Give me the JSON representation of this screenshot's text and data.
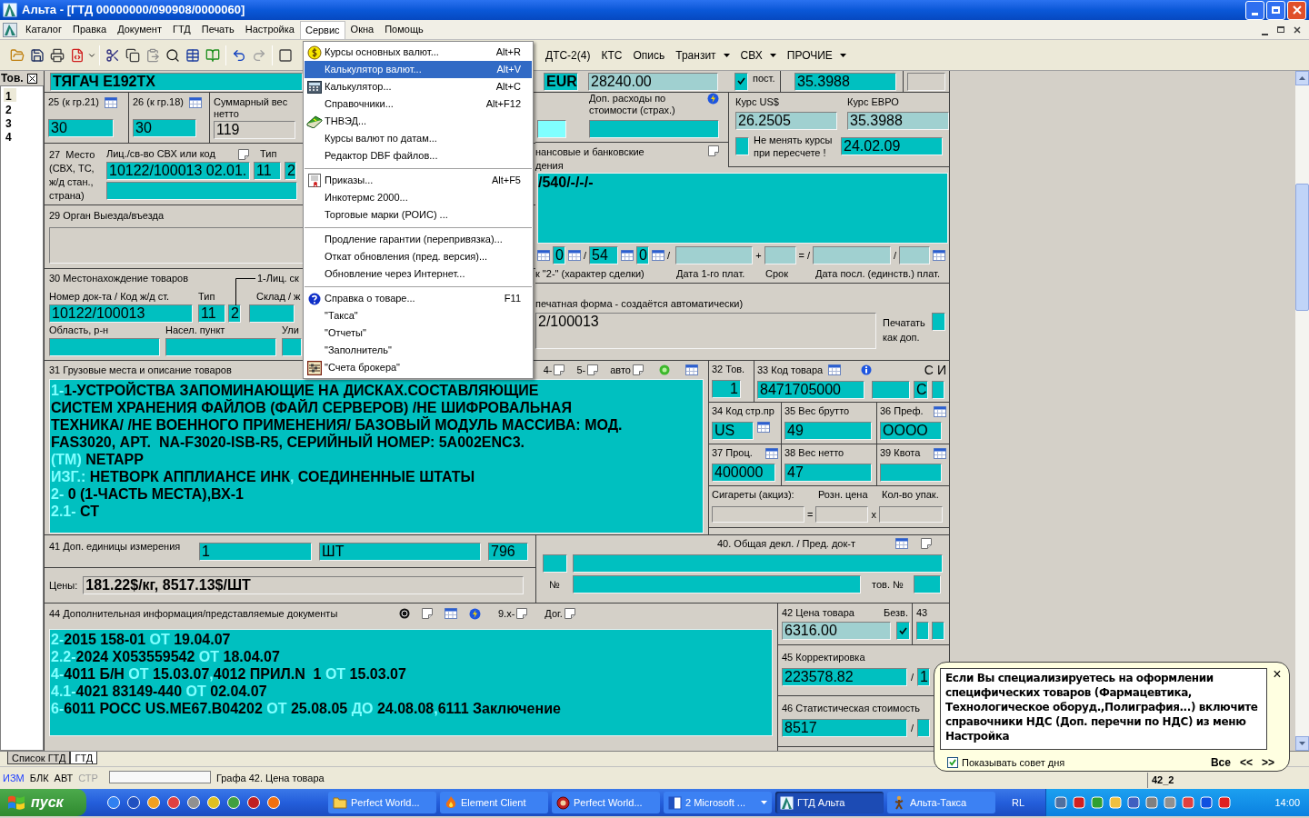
{
  "window": {
    "title": "Альта - [ГТД 00000000/090908/0000060]"
  },
  "menu_bar": [
    {
      "label": "Каталог",
      "selected": false
    },
    {
      "label": "Правка",
      "selected": false
    },
    {
      "label": "Документ",
      "selected": false
    },
    {
      "label": "ГТД",
      "selected": false
    },
    {
      "label": "Печать",
      "selected": false
    },
    {
      "label": "Настройка",
      "selected": false
    },
    {
      "label": "Сервис",
      "selected": true
    },
    {
      "label": "Окна",
      "selected": false
    },
    {
      "label": "Помощь",
      "selected": false
    }
  ],
  "toolbar": {
    "buttons": [
      {
        "label": "ДТС-2(4)",
        "dropdown": false
      },
      {
        "label": "КТС",
        "dropdown": false
      },
      {
        "label": "Опись",
        "dropdown": false
      },
      {
        "label": "Транзит",
        "dropdown": true
      },
      {
        "label": "СВХ",
        "dropdown": true
      },
      {
        "label": "ПРОЧИЕ",
        "dropdown": true
      }
    ]
  },
  "service_menu": {
    "items": [
      {
        "kind": "item",
        "label": "Курсы основных валют...",
        "shortcut": "Alt+R",
        "selected": false
      },
      {
        "kind": "item",
        "label": "Калькулятор валют...",
        "shortcut": "Alt+V",
        "selected": true
      },
      {
        "kind": "item",
        "label": "Калькулятор...",
        "shortcut": "Alt+C",
        "selected": false
      },
      {
        "kind": "item",
        "label": "Справочники...",
        "shortcut": "Alt+F12",
        "selected": false
      },
      {
        "kind": "item",
        "label": "ТНВЭД...",
        "selected": false
      },
      {
        "kind": "item",
        "label": "Курсы валют по датам...",
        "selected": false
      },
      {
        "kind": "item",
        "label": "Редактор DBF файлов...",
        "selected": false
      },
      {
        "kind": "separator"
      },
      {
        "kind": "item",
        "label": "Приказы...",
        "shortcut": "Alt+F5",
        "selected": false
      },
      {
        "kind": "item",
        "label": "Инкотермс 2000...",
        "selected": false
      },
      {
        "kind": "item",
        "label": "Торговые марки (РОИС) ...",
        "selected": false
      },
      {
        "kind": "separator"
      },
      {
        "kind": "item",
        "label": "Продление гарантии (перепривязка)...",
        "selected": false
      },
      {
        "kind": "item",
        "label": "Откат обновления (пред. версия)...",
        "selected": false
      },
      {
        "kind": "item",
        "label": "Обновление через Интернет...",
        "selected": false
      },
      {
        "kind": "separator"
      },
      {
        "kind": "item",
        "label": "Справка о товаре...",
        "shortcut": "F11",
        "selected": false
      },
      {
        "kind": "item",
        "label": "\"Такса\"",
        "selected": false
      },
      {
        "kind": "item",
        "label": "\"Отчеты\"",
        "selected": false
      },
      {
        "kind": "item",
        "label": "\"Заполнитель\"",
        "selected": false
      },
      {
        "kind": "item",
        "label": "\"Счета брокера\"",
        "selected": false
      }
    ]
  },
  "goods_list": {
    "title": "Тов.",
    "items": [
      {
        "label": "1",
        "selected": true
      },
      {
        "label": "2",
        "selected": false
      },
      {
        "label": "3",
        "selected": false
      },
      {
        "label": "4",
        "selected": false
      }
    ]
  },
  "header_row": {
    "description": "ТЯГАЧ Е192ТХ",
    "currency": "EUR",
    "amount": "28240.00",
    "fixed": {
      "label": "пост.",
      "checked": true
    },
    "rate": "35.3988"
  },
  "box25": {
    "label": "25 (к гр.21)",
    "value": "30"
  },
  "box26": {
    "label": "26 (к гр.18)",
    "value": "30"
  },
  "net_total": {
    "label": "Суммарный вес нетто",
    "value": "119"
  },
  "extra_costs": {
    "label": "Доп. расходы по стоимости (страх.)"
  },
  "rates": {
    "usd_label": "Курс US$",
    "usd": "26.2505",
    "eur_label": "Курс ЕВРО",
    "eur": "35.3988",
    "keep": {
      "label": "Не менять курсы при пересчете !",
      "checked": false
    },
    "date": "24.02.09"
  },
  "box27": {
    "label": "27  Место (СВХ, ТС, ж/д стан., страна)",
    "license_label": "Лиц./св-во СВХ или код",
    "type_label": "Тип",
    "license": "10122/100013 02.01.",
    "type": "11",
    "code": "2"
  },
  "finance": {
    "label_lines": [
      "нансовые и банковские",
      "дения"
    ],
    "value": "/540/-/-/-",
    "terms": [
      "0",
      "54",
      "0"
    ],
    "signs": [
      "/",
      "/",
      "+",
      "= /",
      "/"
    ],
    "captions": [
      "к \"2-\" (характер сделки)",
      "Дата 1-го плат.",
      "Срок",
      "Дата посл. (единств.) плат."
    ]
  },
  "box29": {
    "label": "29 Орган Выезда/въезда"
  },
  "box30": {
    "label": "30 Местонахождение товаров",
    "license_caption": "1-Лиц. ск",
    "doc_label": "Номер док-та / Код ж/д ст.",
    "type_label": "Тип",
    "store_label": "Склад / ж",
    "doc": "10122/100013",
    "type": "11",
    "code": "2",
    "region_label": "Область, р-н",
    "town_label": "Насел. пункт",
    "street_label": "Ули"
  },
  "print_form": {
    "label": "печатная форма - создаётся автоматически)",
    "value": "2/100013",
    "extra_label": "Печатать как доп.",
    "extra_checked": false
  },
  "box31": {
    "label": "31 Грузовые места и описание товаров",
    "tools": [
      "4-",
      "5-",
      "авто"
    ],
    "lines": [
      [
        {
          "kind": "marker",
          "text": "1-"
        },
        {
          "kind": "text",
          "text": "1-УСТРОЙСТВА ЗАПОМИНАЮЩИЕ НА ДИСКАХ.СОСТАВЛЯЮЩИЕ"
        }
      ],
      [
        {
          "kind": "text",
          "text": "СИСТЕМ ХРАНЕНИЯ ФАЙЛОВ (ФАЙЛ СЕРВЕРОВ) /НЕ ШИФРОВАЛЬНАЯ"
        }
      ],
      [
        {
          "kind": "text",
          "text": "ТЕХНИКА/ /НЕ ВОЕННОГО ПРИМЕНЕНИЯ/ БАЗОВЫЙ МОДУЛЬ МАССИВА: МОД."
        }
      ],
      [
        {
          "kind": "text",
          "text": "FAS3020, АРТ.  NA-F3020-ISB-R5, СЕРИЙНЫЙ НОМЕР: 5A002ENC3."
        }
      ],
      [
        {
          "kind": "marker",
          "text": "(ТМ) "
        },
        {
          "kind": "text",
          "text": "NETAPP"
        }
      ],
      [
        {
          "kind": "marker",
          "text": "ИЗГ.: "
        },
        {
          "kind": "text",
          "text": "НЕТВОРК АППЛИАНСЕ ИНК"
        },
        {
          "kind": "marker",
          "text": ", "
        },
        {
          "kind": "text",
          "text": "СОЕДИНЕННЫЕ ШТАТЫ"
        }
      ],
      [
        {
          "kind": "marker",
          "text": "2- "
        },
        {
          "kind": "text",
          "text": "0 (1-ЧАСТЬ МЕСТА),ВХ-1"
        }
      ],
      [
        {
          "kind": "marker",
          "text": "2.1- "
        },
        {
          "kind": "text",
          "text": "СТ"
        }
      ]
    ]
  },
  "box32": {
    "label": "32 Тов.",
    "value": "1"
  },
  "box33": {
    "label": "33 Код товара",
    "value": "8471705000",
    "flag_labels": [
      "С",
      "И"
    ],
    "flag": "С"
  },
  "box34": {
    "label": "34 Код стр.пр",
    "value": "US"
  },
  "box35": {
    "label": "35 Вес брутто",
    "value": "49"
  },
  "box36": {
    "label": "36 Преф.",
    "value": "ОООО"
  },
  "box37": {
    "label": "37 Проц.",
    "value": "400000"
  },
  "box38": {
    "label": "38 Вес нетто",
    "value": "47"
  },
  "box39": {
    "label": "39 Квота"
  },
  "cigarettes": {
    "labels": [
      "Сигареты (акциз):",
      "Розн. цена",
      "Кол-во упак."
    ],
    "signs": [
      "=",
      "x"
    ]
  },
  "box40": {
    "label": "40. Общая декл. / Пред. док-т",
    "number_label": "№",
    "item_label": "тов. №"
  },
  "box41": {
    "label": "41 Доп. единицы измерения",
    "qty": "1",
    "unit": "ШТ",
    "code": "796"
  },
  "prices": {
    "label": "Цены:",
    "value": "181.22$/кг,  8517.13$/ШТ"
  },
  "box44": {
    "label": "44 Дополнительная информация/представляемые документы",
    "tools": [
      "9.х-",
      "Дог."
    ],
    "lines": [
      [
        {
          "kind": "marker",
          "text": "2-"
        },
        {
          "kind": "text",
          "text": "2015 158-01 "
        },
        {
          "kind": "marker",
          "text": "ОТ "
        },
        {
          "kind": "text",
          "text": "19.04.07"
        }
      ],
      [
        {
          "kind": "marker",
          "text": "2.2-"
        },
        {
          "kind": "text",
          "text": "2024 X053559542 "
        },
        {
          "kind": "marker",
          "text": "ОТ "
        },
        {
          "kind": "text",
          "text": "18.04.07"
        }
      ],
      [
        {
          "kind": "marker",
          "text": "4-"
        },
        {
          "kind": "text",
          "text": "4011 Б/Н "
        },
        {
          "kind": "marker",
          "text": "ОТ "
        },
        {
          "kind": "text",
          "text": "15.03.07"
        },
        {
          "kind": "marker",
          "text": ","
        },
        {
          "kind": "text",
          "text": "4012 ПРИЛ.N  1 "
        },
        {
          "kind": "marker",
          "text": "ОТ "
        },
        {
          "kind": "text",
          "text": "15.03.07"
        }
      ],
      [
        {
          "kind": "marker",
          "text": "4.1-"
        },
        {
          "kind": "text",
          "text": "4021 83149-440 "
        },
        {
          "kind": "marker",
          "text": "ОТ "
        },
        {
          "kind": "text",
          "text": "02.04.07"
        }
      ],
      [
        {
          "kind": "marker",
          "text": "6-"
        },
        {
          "kind": "text",
          "text": "6011 РОСС US.ME67.B04202 "
        },
        {
          "kind": "marker",
          "text": "ОТ "
        },
        {
          "kind": "text",
          "text": "25.08.05 "
        },
        {
          "kind": "marker",
          "text": "ДО "
        },
        {
          "kind": "text",
          "text": "24.08.08"
        },
        {
          "kind": "marker",
          "text": ","
        },
        {
          "kind": "text",
          "text": "6111 Заключение"
        }
      ]
    ]
  },
  "box42": {
    "label": "42 Цена товара",
    "free_label": "Безв.",
    "value": "6316.00",
    "free_checked": true
  },
  "box43": {
    "label": "43"
  },
  "box45": {
    "label": "45 Корректировка",
    "value": "223578.82",
    "separator": "/",
    "rate": "1"
  },
  "box46": {
    "label": "46 Статистическая стоимость",
    "value": "8517",
    "separator": "/"
  },
  "doc_tabs": [
    {
      "label": "Список ГТД",
      "selected": false
    },
    {
      "label": "ГТД",
      "selected": true
    }
  ],
  "status_bar": {
    "flags": [
      {
        "label": "ИЗМ",
        "kind": "active"
      },
      {
        "label": "БЛК",
        "kind": "normal"
      },
      {
        "label": "АВТ",
        "kind": "normal"
      },
      {
        "label": "СТР",
        "kind": "disabled"
      }
    ],
    "hint": "Графа 42. Цена товара",
    "field": "42_2"
  },
  "tip": {
    "text": "Если Вы специализируетесь на оформлении специфических товаров (Фармацевтика, Технологическое оборуд.,Полиграфия...) включите справочники НДС (Доп. перечни по НДС) из меню Настройка",
    "close": "×",
    "show_on_start": {
      "label": "Показывать совет дня",
      "checked": true
    },
    "buttons": [
      "Все",
      "<<",
      ">>"
    ]
  },
  "taskbar": {
    "start": "пуск",
    "tasks": [
      {
        "label": "Perfect World...",
        "selected": false,
        "dropdown": false
      },
      {
        "label": "Element Client",
        "selected": false,
        "dropdown": false
      },
      {
        "label": "Perfect World...",
        "selected": false,
        "dropdown": false
      },
      {
        "label": "2 Microsoft ...",
        "selected": false,
        "dropdown": true
      },
      {
        "label": "ГТД Альта",
        "selected": true,
        "dropdown": false
      },
      {
        "label": "Альта-Такса",
        "selected": false,
        "dropdown": false
      }
    ],
    "language": "RL",
    "clock": "14:00"
  }
}
